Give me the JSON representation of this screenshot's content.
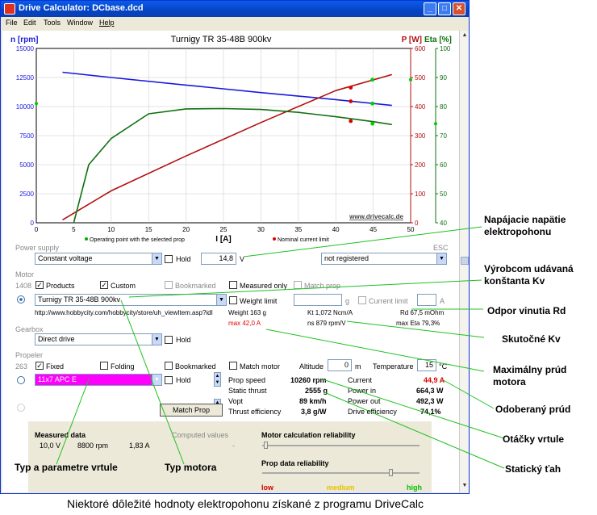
{
  "window": {
    "title": "Drive Calculator: DCbase.dcd",
    "buttons": [
      "_",
      "□",
      "✕"
    ]
  },
  "menu": [
    "File",
    "Edit",
    "Tools",
    "Window",
    "Help"
  ],
  "chart": {
    "title": "Turnigy TR 35-48B 900kv",
    "left_axis_label": "n [rpm]",
    "right_axis_label_1": "P [W]",
    "right_axis_label_2": "Eta [%]",
    "x_axis_label": "I [A]",
    "watermark": "www.drivecalc.de",
    "legend_green": "Operating point with the selected prop",
    "legend_red": "Nominal current limit",
    "colors": {
      "rpm": "#1a1adc",
      "power": "#b01010",
      "eta": "#107010"
    }
  },
  "chart_data": {
    "type": "line",
    "title": "Turnigy TR 35-48B 900kv",
    "xlabel": "I [A]",
    "x_ticks": [
      "0",
      "5",
      "10",
      "15",
      "20",
      "25",
      "30",
      "35",
      "40",
      "45",
      "50"
    ],
    "y_left": {
      "label": "n [rpm]",
      "ticks": [
        "0",
        "2500",
        "5000",
        "7500",
        "10000",
        "12500",
        "15000"
      ],
      "lim": [
        0,
        15000
      ]
    },
    "y_right_power": {
      "label": "P [W]",
      "ticks": [
        "0",
        "100",
        "200",
        "300",
        "400",
        "500",
        "600"
      ],
      "lim": [
        0,
        600
      ]
    },
    "y_right_eta": {
      "label": "Eta [%]",
      "ticks": [
        "40",
        "50",
        "60",
        "70",
        "80",
        "90",
        "100"
      ],
      "lim": [
        40,
        100
      ]
    },
    "series": [
      {
        "name": "n [rpm]",
        "axis": "left",
        "x": [
          3.5,
          10,
          20,
          30,
          40,
          47.5
        ],
        "values": [
          12950,
          12500,
          11850,
          11200,
          10600,
          10100
        ]
      },
      {
        "name": "P [W]",
        "axis": "power",
        "x": [
          3.5,
          10,
          20,
          30,
          40,
          47.5
        ],
        "values": [
          10,
          110,
          230,
          345,
          455,
          510
        ]
      },
      {
        "name": "Eta [%]",
        "axis": "eta",
        "x": [
          5,
          7,
          10,
          15,
          20,
          25,
          30,
          35,
          40,
          45,
          47.5
        ],
        "values": [
          40,
          60,
          69,
          77.5,
          79.2,
          79.3,
          79,
          78,
          76.5,
          74.8,
          73.8
        ]
      }
    ],
    "markers": {
      "operating_point": {
        "x": 44.9,
        "eta": 74.1,
        "rpm": 10260,
        "power": 492.3
      },
      "nominal_current_limit": {
        "x": 42.0,
        "eta": 75.0,
        "rpm": 10450,
        "power": 465
      }
    }
  },
  "form": {
    "power_supply_label": "Power supply",
    "esc_label": "ESC",
    "supply_mode": "Constant voltage",
    "hold": "Hold",
    "voltage": "14,8",
    "voltage_unit": "V",
    "esc_value": "not registered",
    "motor_label": "Motor",
    "motor_count": "1408",
    "products": "Products",
    "custom": "Custom",
    "bookmarked": "Bookmarked",
    "measured_only": "Measured only",
    "match_prop": "Match prop",
    "motor_value": "Turnigy TR 35-48B 900kv",
    "weight_limit": "Weight limit",
    "g_unit": "g",
    "current_limit": "Current limit",
    "a_unit": "A",
    "url": "http://www.hobbycity.com/hobbycity/store/uh_viewItem.asp?idI",
    "weight": "Weight 163 g",
    "kt": "Kt 1,072 Ncm/A",
    "rd": "Rd 67,5 mOhm",
    "max_current": "max 42,0 A",
    "ns": "ns 879 rpm/V",
    "max_eta": "max Eta 79,3%",
    "gearbox_label": "Gearbox",
    "gearbox_value": "Direct drive",
    "propeller_label": "Propeler",
    "prop_count": "263",
    "fixed": "Fixed",
    "folding": "Folding",
    "bookmarked2": "Bookmarked",
    "match_motor": "Match motor",
    "altitude_label": "Altitude",
    "altitude": "0",
    "m_unit": "m",
    "temperature_label": "Temperature",
    "temperature": "15",
    "c_unit": "°C",
    "prop_value": "11x7 APC E",
    "match_prop_button": "Match Prop"
  },
  "results": {
    "prop_speed_label": "Prop speed",
    "prop_speed": "10260 rpm",
    "static_thrust_label": "Static thrust",
    "static_thrust": "2555 g",
    "vopt_label": "Vopt",
    "vopt": "89 km/h",
    "thrust_eff_label": "Thrust efficiency",
    "thrust_eff": "3,8 g/W",
    "current_label": "Current",
    "current": "44,9 A",
    "power_in_label": "Power in",
    "power_in": "664,3 W",
    "power_out_label": "Power out",
    "power_out": "492,3 W",
    "drive_eff_label": "Drive efficiency",
    "drive_eff": "74,1%"
  },
  "bottom": {
    "measured_data": "Measured data",
    "measured_v": "10,0 V",
    "measured_rpm": "8800 rpm",
    "measured_a": "1,83 A",
    "computed_values": "Computed values",
    "computed_dash": "-",
    "motor_calc_rel": "Motor calculation reliability",
    "prop_data_rel": "Prop data reliability",
    "low": "low",
    "medium": "medium",
    "high": "high"
  },
  "annotations": {
    "a1": "Napájacie napätie elektropohonu",
    "a2": "Výrobcom udávaná konštanta Kv",
    "a3": "Odpor vinutia Rd",
    "a4": "Skutočné Kv",
    "a5": "Maximálny prúd motora",
    "a6": "Odoberaný prúd",
    "a7": "Otáčky vrtule",
    "a8": "Statický ťah",
    "a9": "Typ a parametre vrtule",
    "a10": "Typ motora",
    "caption": "Niektoré dôležité hodnoty elektropohonu získané z programu DriveCalc"
  }
}
